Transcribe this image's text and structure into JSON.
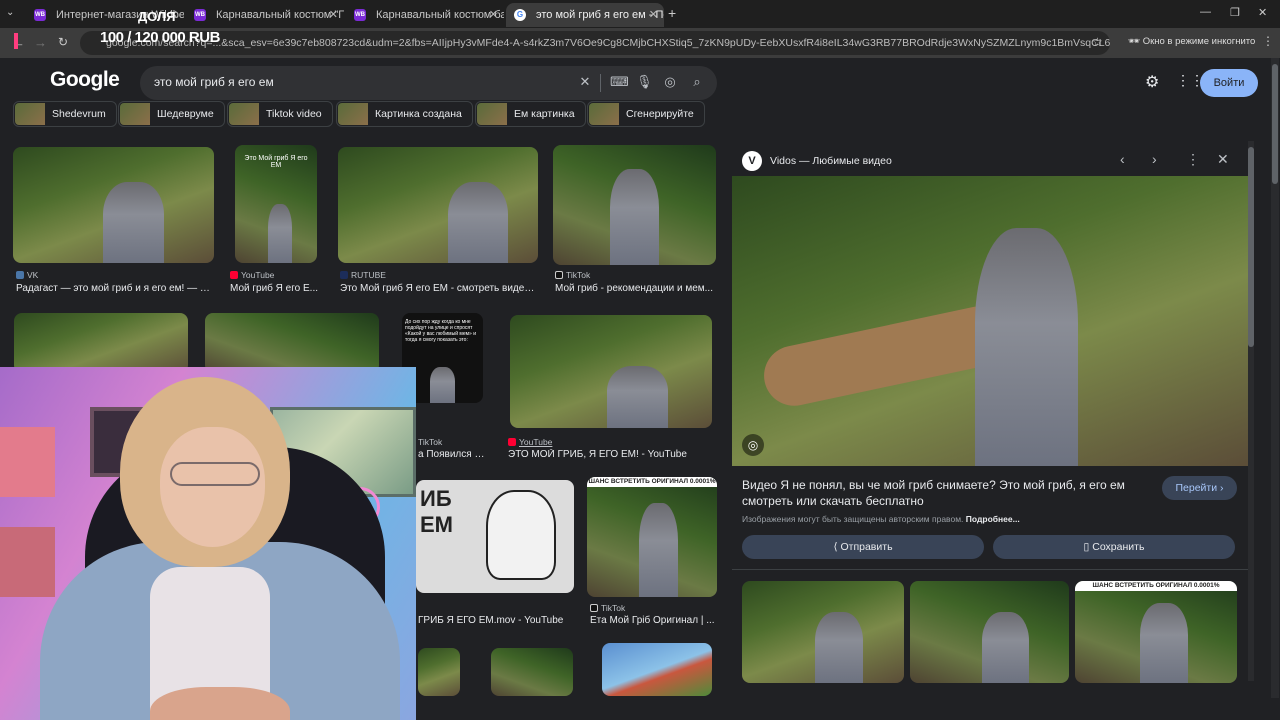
{
  "tabs": [
    {
      "label": "Интернет-магазин Wildberries",
      "icon": "WB"
    },
    {
      "label": "Карнавальный костюм \"Приз",
      "icon": "WB"
    },
    {
      "label": "Карнавальный костюм банан",
      "icon": "WB"
    },
    {
      "label": "это мой гриб я его ем - Поиск",
      "icon": "G"
    }
  ],
  "overlay": {
    "donate_label": "ДОЛЯ",
    "goal": "100 / 120 000 RUB"
  },
  "omnibox": {
    "url": "google.com/search?q=...&sca_esv=6e39c7eb808723cd&udm=2&fbs=AIIjpHy3vMFde4-A-s4rkZ3m7V6Oe9Cg8CMjbCHXStiq5_7zKN9pUDy-EebXUsxfR4i8eIL34wG3RB77BROdRdje3WxNySZMZLnym9c1BmVsqCL6aNdcE2DUPMPUGfNZ6uxbcHy..."
  },
  "incognito": "Окно в режиме инкогнито",
  "google": {
    "logo": "Google",
    "query": "это мой гриб я его ем",
    "signin": "Войти"
  },
  "chips": [
    "Shedevrum",
    "Шедеврумe",
    "Tiktok video",
    "Картинка создана",
    "Ем картинка",
    "Сгенерируйте"
  ],
  "results_row1": [
    {
      "source": "VK",
      "caption": "Радагаст — это мой гриб и я его ем! — В..."
    },
    {
      "source": "YouTube",
      "caption": "Мой гриб Я его Е..."
    },
    {
      "source": "RUTUBE",
      "caption": "Это Мой гриб Я его ЕМ - смотреть видео..."
    },
    {
      "source": "TikTok",
      "caption": "Мой гриб - рекомендации и мем..."
    }
  ],
  "results_row2": [
    {
      "source": "TikTok",
      "caption": "а Появился М..."
    },
    {
      "source": "YouTube",
      "caption": "ЭТО МОЙ ГРИБ, Я ЕГО ЕМ! - YouTube"
    }
  ],
  "results_row3": [
    {
      "source": "",
      "caption": "ГРИБ Я ЕГО ЕМ.mov - YouTube"
    },
    {
      "source": "TikTok",
      "caption": "Ета Мой Гріб Оригинал | ..."
    }
  ],
  "thumb_texts": {
    "row1_b": "Это Мой гриб Я его ЕМ",
    "row2_c": "До сих пор жду когда ко мне подойдут на улице и спросят «Какой у вас любимый мем» и тогда я смогу показать это:",
    "row3_b": "ШАНС ВСТРЕТИТЬ ОРИГИНАЛ 0.0001%",
    "panel_thumb": "ШАНС ВСТРЕТИТЬ ОРИГИНАЛ 0.0001%"
  },
  "panel": {
    "source": "Vidos — Любимые видео",
    "title": "Видео Я не понял, вы че мой гриб снимаете? Это мой гриб, я его ем смотреть или скачать бесплатно",
    "note": "Изображения могут быть защищены авторским правом.",
    "more": "Подробнее...",
    "visit": "Перейти",
    "share": "Отправить",
    "save": "Сохранить"
  },
  "colors": {
    "accent": "#8ab4f8",
    "bg": "#202124",
    "wb_purple": "#7b2bd6"
  }
}
